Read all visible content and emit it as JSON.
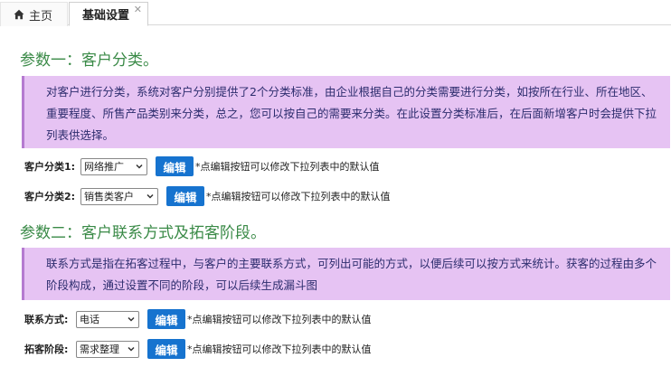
{
  "tabs": {
    "home_label": "主页",
    "active_label": "基础设置",
    "close_symbol": "✕"
  },
  "section1": {
    "title": "参数一：客户分类。",
    "notice": "对客户进行分类，系统对客户分别提供了2个分类标准，由企业根据自己的分类需要进行分类，如按所在行业、所在地区、重要程度、所售产品类别来分类，总之，您可以按自己的需要来分类。在此设置分类标准后，在后面新增客户时会提供下拉列表供选择。",
    "rows": [
      {
        "label": "客户分类1:",
        "value": "网络推广",
        "button": "编辑",
        "note": "*点编辑按钮可以修改下拉列表中的默认值"
      },
      {
        "label": "客户分类2:",
        "value": "销售类客户",
        "button": "编辑",
        "note": "*点编辑按钮可以修改下拉列表中的默认值"
      }
    ]
  },
  "section2": {
    "title": "参数二：客户联系方式及拓客阶段。",
    "notice": "联系方式是指在拓客过程中，与客户的主要联系方式，可列出可能的方式，以便后续可以按方式来统计。获客的过程由多个阶段构成，通过设置不同的阶段，可以后续生成漏斗图",
    "rows": [
      {
        "label": "联系方式:",
        "value": "电话",
        "button": "编辑",
        "note": "*点编辑按钮可以修改下拉列表中的默认值"
      },
      {
        "label": "拓客阶段:",
        "value": "需求整理",
        "button": "编辑",
        "note": "*点编辑按钮可以修改下拉列表中的默认值"
      }
    ]
  },
  "colors": {
    "accent_title": "#3a8a47",
    "notice_bg": "#e6c3f3",
    "notice_border": "#b57ad0",
    "button_bg": "#1673cf"
  }
}
